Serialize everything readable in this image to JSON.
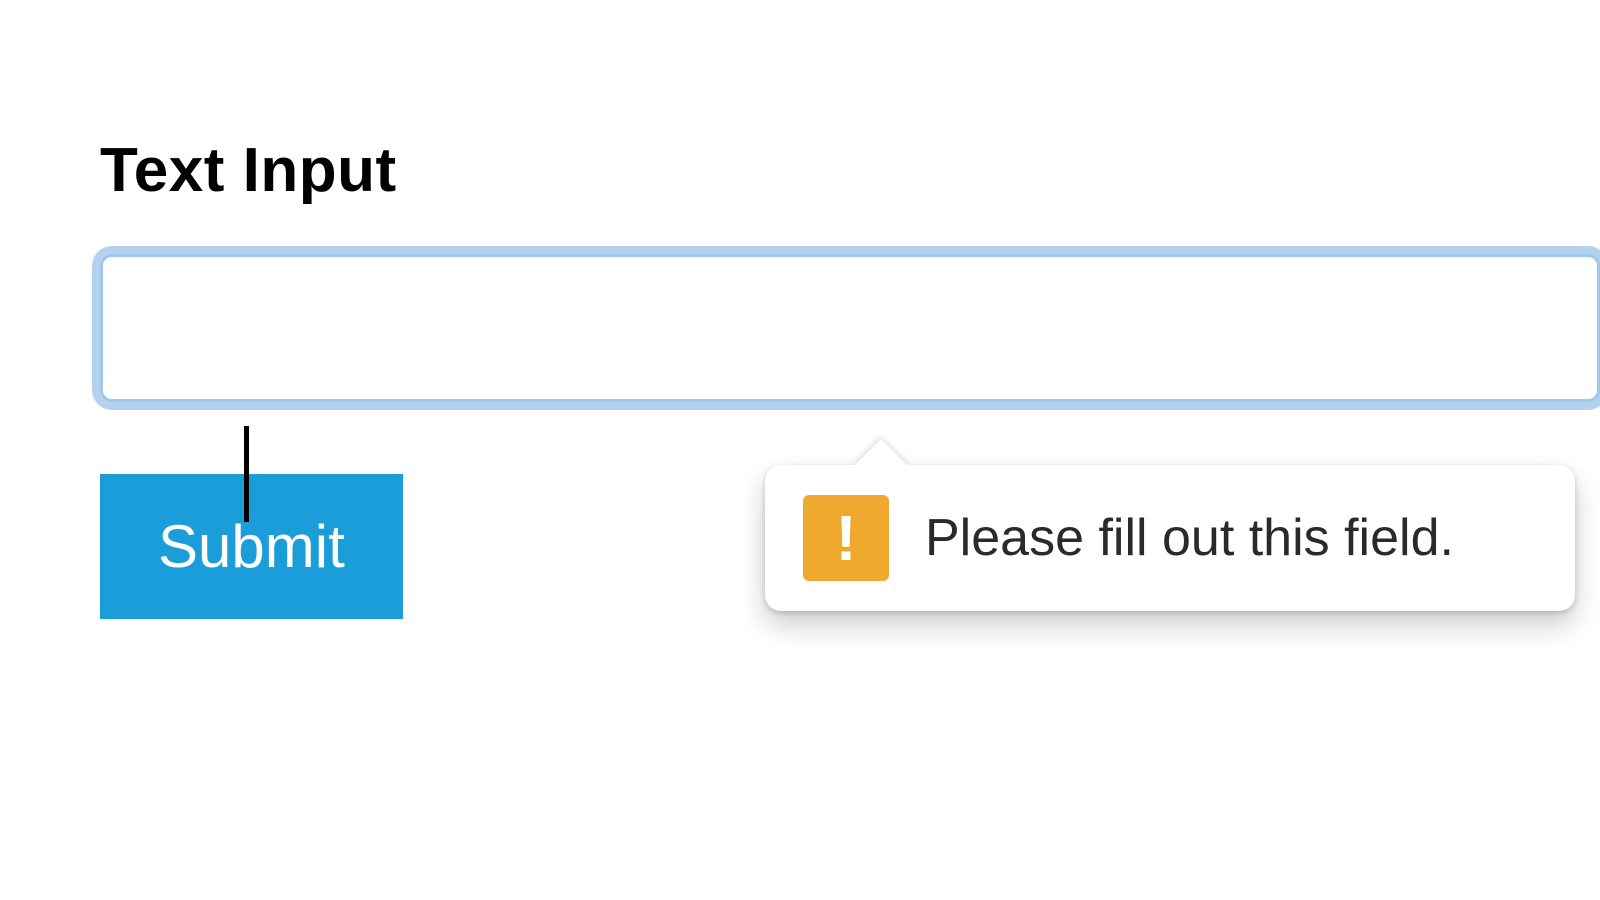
{
  "form": {
    "label": "Text Input",
    "input_value": "",
    "input_placeholder": "",
    "submit_label": "Submit"
  },
  "validation": {
    "message": "Please fill out this field.",
    "icon_glyph": "!"
  }
}
